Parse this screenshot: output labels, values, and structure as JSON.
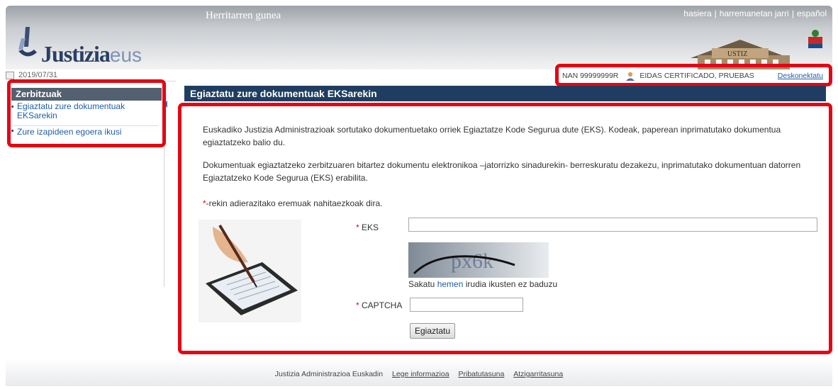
{
  "header": {
    "site_title": "Herritarren gunea",
    "links": [
      "hasiera",
      "harremanetan jarri",
      "español"
    ],
    "logo_main": "Justizia",
    "logo_suffix": "eus"
  },
  "date": "2019/07/31",
  "user_bar": {
    "nan": "NAN 99999999R",
    "user_name": "EIDAS CERTIFICADO, PRUEBAS",
    "logout": "Deskonektatu"
  },
  "sidebar": {
    "title": "Zerbitzuak",
    "items": [
      {
        "label": "Egiaztatu zure dokumentuak EKSarekin"
      },
      {
        "label": "Zure izapideen egoera ikusi"
      }
    ]
  },
  "main": {
    "title": "Egiaztatu zure dokumentuak EKSarekin",
    "paragraph1": "Euskadiko Justizia Administrazioak sortutako dokumentuetako orriek Egiaztatze Kode Segurua dute (EKS). Kodeak, paperean inprimatutako dokumentua egiaztatzeko balio du.",
    "paragraph2": "Dokumentuak egiaztatzeko zerbitzuaren bitartez dokumentu elektronikoa –jatorrizko sinadurekin- berreskuratu dezakezu, inprimatutako dokumentuan datorren Egiaztatzeko Kode Segurua (EKS) erabilita.",
    "required_star": "*",
    "required_note": "-rekin adierazitako eremuak nahitaezkoak dira.",
    "eks_label": "EKS",
    "eks_value": "",
    "captcha_text": "px6k",
    "hint_before": "Sakatu ",
    "hint_link": "hemen",
    "hint_after": " irudia ikusten ez baduzu",
    "captcha_label": "CAPTCHA",
    "captcha_value": "",
    "submit_label": "Egiaztatu"
  },
  "footer": {
    "org": "Justizia Administrazioa Euskadin",
    "links": [
      "Lege informazioa",
      "Pribatutasuna",
      "Atzigarritasuna"
    ]
  },
  "colors": {
    "highlight": "#e30613",
    "title_bar": "#1f3d60",
    "sidebar_title": "#53606f",
    "link": "#1f5ea8"
  }
}
